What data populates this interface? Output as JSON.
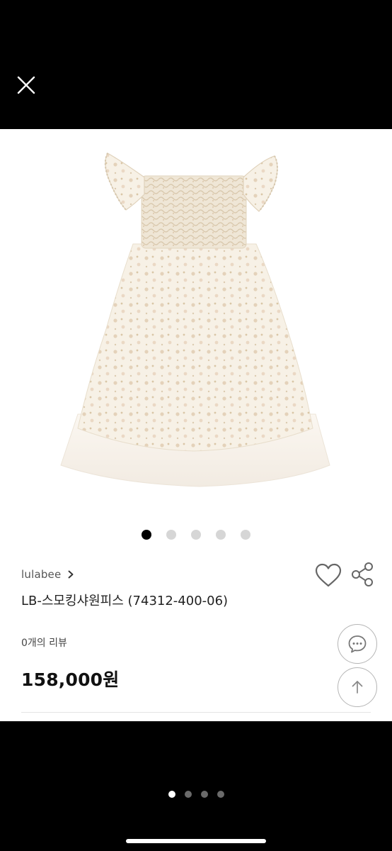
{
  "product": {
    "brand": "lulabee",
    "name": "LB-스모킹샤원피스 (74312-400-06)",
    "review_count_text": "0개의 리뷰",
    "price": "158,000원"
  },
  "carousel": {
    "total": 5,
    "active_index": 1
  },
  "pager": {
    "total": 4,
    "active_index": 1
  },
  "icons": {
    "close": "close-icon",
    "chevron": "chevron-right-icon",
    "heart": "heart-icon",
    "share": "share-icon",
    "chat": "chat-icon",
    "scroll_top": "arrow-up-icon"
  },
  "colors": {
    "background": "#000000",
    "sheet": "#ffffff",
    "dot_active": "#000000",
    "dot_inactive": "#d6d6d6"
  }
}
